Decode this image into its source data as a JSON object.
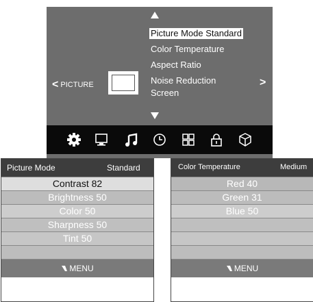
{
  "osd": {
    "menu_items": [
      "Picture Mode Standard",
      "Color Temperature",
      "Aspect Ratio",
      "Noise Reduction",
      "Screen"
    ],
    "nav_left_glyph": "<",
    "nav_left_label": "PICTURE",
    "nav_right_glyph": ">",
    "icons": [
      "gear-icon",
      "monitor-icon",
      "music-note-icon",
      "clock-icon",
      "grid-icon",
      "lock-icon",
      "cube-icon"
    ]
  },
  "left_table": {
    "header_label": "Picture Mode",
    "header_value": "Standard",
    "rows": [
      "Contrast 82",
      "Brightness 50",
      "Color 50",
      "Sharpness 50",
      "Tint 50",
      ""
    ],
    "footer": "MENU"
  },
  "right_table": {
    "header_label": "Color Temperature",
    "header_value": "Medium",
    "rows": [
      "Red 40",
      "Green 31",
      "Blue 50",
      "",
      "",
      ""
    ],
    "footer": "MENU"
  },
  "colors": {
    "osd_background": "#6d6d6d",
    "icon_bar": "#0a0a0a",
    "table_header": "#3d3d3d"
  }
}
